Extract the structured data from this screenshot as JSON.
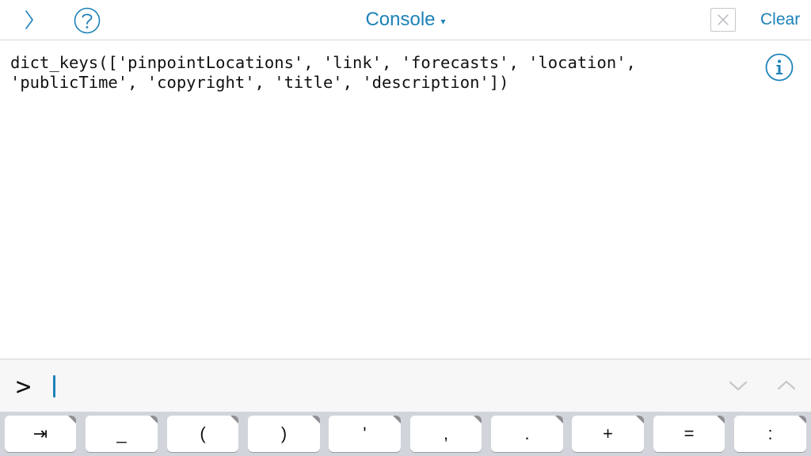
{
  "header": {
    "title": "Console",
    "title_caret": "▾",
    "clear_label": "Clear",
    "icons": {
      "back": "chevron-right-icon",
      "help": "question-circle-icon",
      "close": "close-box-icon",
      "info": "info-circle-icon"
    }
  },
  "output": {
    "lines": [
      "dict_keys(['pinpointLocations', 'link', 'forecasts', 'location',",
      "'publicTime', 'copyright', 'title', 'description'])"
    ]
  },
  "prompt": {
    "symbol": ">",
    "value": ""
  },
  "history_icons": {
    "down": "chevron-down-icon",
    "up": "chevron-up-icon"
  },
  "keyboard": {
    "keys": [
      {
        "label": "⇥",
        "name": "tab-key"
      },
      {
        "label": "_",
        "name": "underscore-key"
      },
      {
        "label": "(",
        "name": "open-paren-key"
      },
      {
        "label": ")",
        "name": "close-paren-key"
      },
      {
        "label": "'",
        "name": "quote-key"
      },
      {
        "label": ",",
        "name": "comma-key"
      },
      {
        "label": ".",
        "name": "period-key"
      },
      {
        "label": "+",
        "name": "plus-key"
      },
      {
        "label": "=",
        "name": "equals-key"
      },
      {
        "label": ":",
        "name": "colon-key"
      }
    ]
  },
  "colors": {
    "accent": "#1d82b8",
    "key_row_bg": "#d1d5db",
    "prompt_bar_bg": "#f7f7f7"
  }
}
